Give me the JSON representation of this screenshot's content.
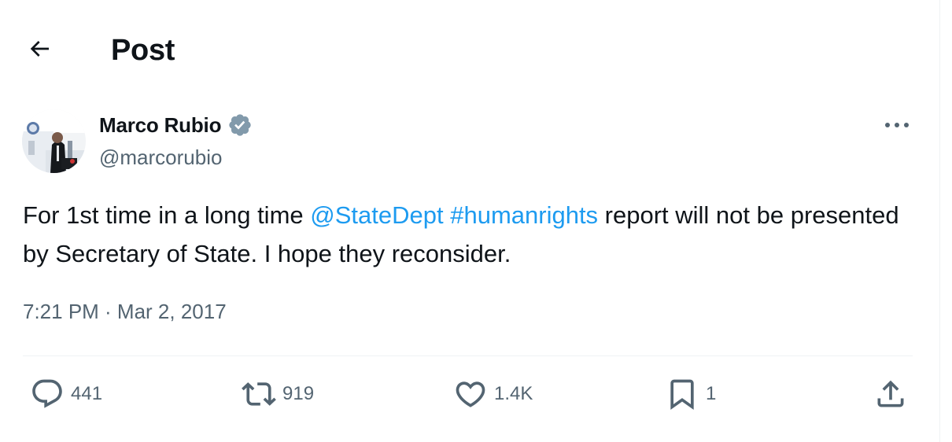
{
  "header": {
    "title": "Post",
    "back_icon": "arrow-left-icon"
  },
  "author": {
    "name": "Marco Rubio",
    "handle": "@marcorubio",
    "verified_icon": "verified-badge-icon",
    "verified_color": "#829aab"
  },
  "tweet": {
    "text_before": "For 1st time in a long time ",
    "mention": "@StateDept",
    "space": " ",
    "hashtag": "#humanrights",
    "text_after": " report will not be presented by Secretary of State. I hope they reconsider.",
    "timestamp": "7:21 PM · Mar 2, 2017"
  },
  "actions": {
    "replies": "441",
    "reposts": "919",
    "likes": "1.4K",
    "bookmarks": "1"
  },
  "colors": {
    "link": "#1d9bf0",
    "secondary_text": "#536471",
    "primary_text": "#0f1419",
    "divider": "#eff3f4"
  }
}
